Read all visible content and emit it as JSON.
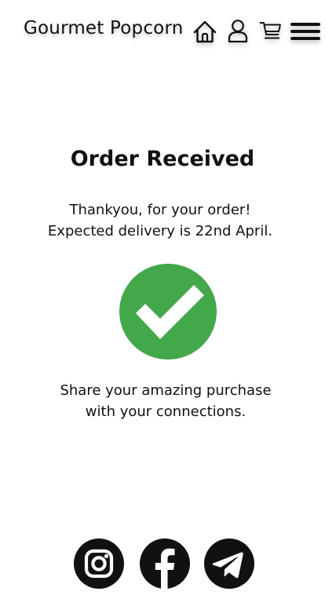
{
  "header": {
    "brand": "Gourmet Popcorn",
    "icons": [
      "home-icon",
      "user-icon",
      "cart-icon",
      "hamburger-menu-icon"
    ]
  },
  "main": {
    "title": "Order Received",
    "thanks_line": "Thankyou, for your order!",
    "delivery_line": "Expected delivery is 22nd April.",
    "status_icon": "check-circle-icon",
    "share_line_1": "Share your amazing purchase",
    "share_line_2": "with your connections."
  },
  "social": {
    "icons": [
      "instagram-icon",
      "facebook-icon",
      "telegram-icon"
    ]
  },
  "colors": {
    "text": "#111111",
    "success_green": "#43A84A",
    "background": "#FFFFFF"
  }
}
